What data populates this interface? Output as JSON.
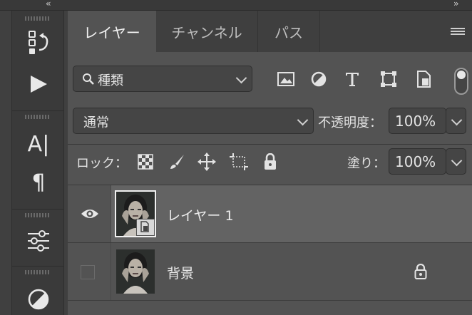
{
  "topbar": {
    "left_collapse": "‹‹",
    "right_collapse": "››"
  },
  "tools": [
    {
      "icon": "history-icon"
    },
    {
      "icon": "play-icon"
    },
    {
      "icon": "character-icon",
      "glyph": "A|"
    },
    {
      "icon": "paragraph-icon",
      "glyph": "¶"
    },
    {
      "icon": "adjustments-icon"
    },
    {
      "icon": "adjustment-layer-icon"
    }
  ],
  "tabs": [
    {
      "label": "レイヤー",
      "active": true
    },
    {
      "label": "チャンネル",
      "active": false
    },
    {
      "label": "パス",
      "active": false
    }
  ],
  "filter": {
    "kind_label": "種類",
    "icons": [
      "image-filter-icon",
      "adjustment-filter-icon",
      "type-filter-icon",
      "shape-filter-icon",
      "smart-object-filter-icon"
    ],
    "toggle_on": true
  },
  "blend": {
    "mode": "通常",
    "opacity_label": "不透明度：",
    "opacity_value": "100%"
  },
  "lock": {
    "label": "ロック：",
    "icons": [
      "lock-transparent-icon",
      "lock-image-icon",
      "lock-position-icon",
      "lock-artboard-icon",
      "lock-all-icon"
    ],
    "fill_label": "塗り：",
    "fill_value": "100%"
  },
  "layers": [
    {
      "name": "レイヤー 1",
      "visible": true,
      "selected": true,
      "smart_object": true,
      "locked": false
    },
    {
      "name": "背景",
      "visible": false,
      "selected": false,
      "smart_object": false,
      "locked": true
    }
  ],
  "colors": {
    "panel_bg": "#535353",
    "selected_row": "#636363",
    "tab_bar": "#3f3f3f"
  }
}
